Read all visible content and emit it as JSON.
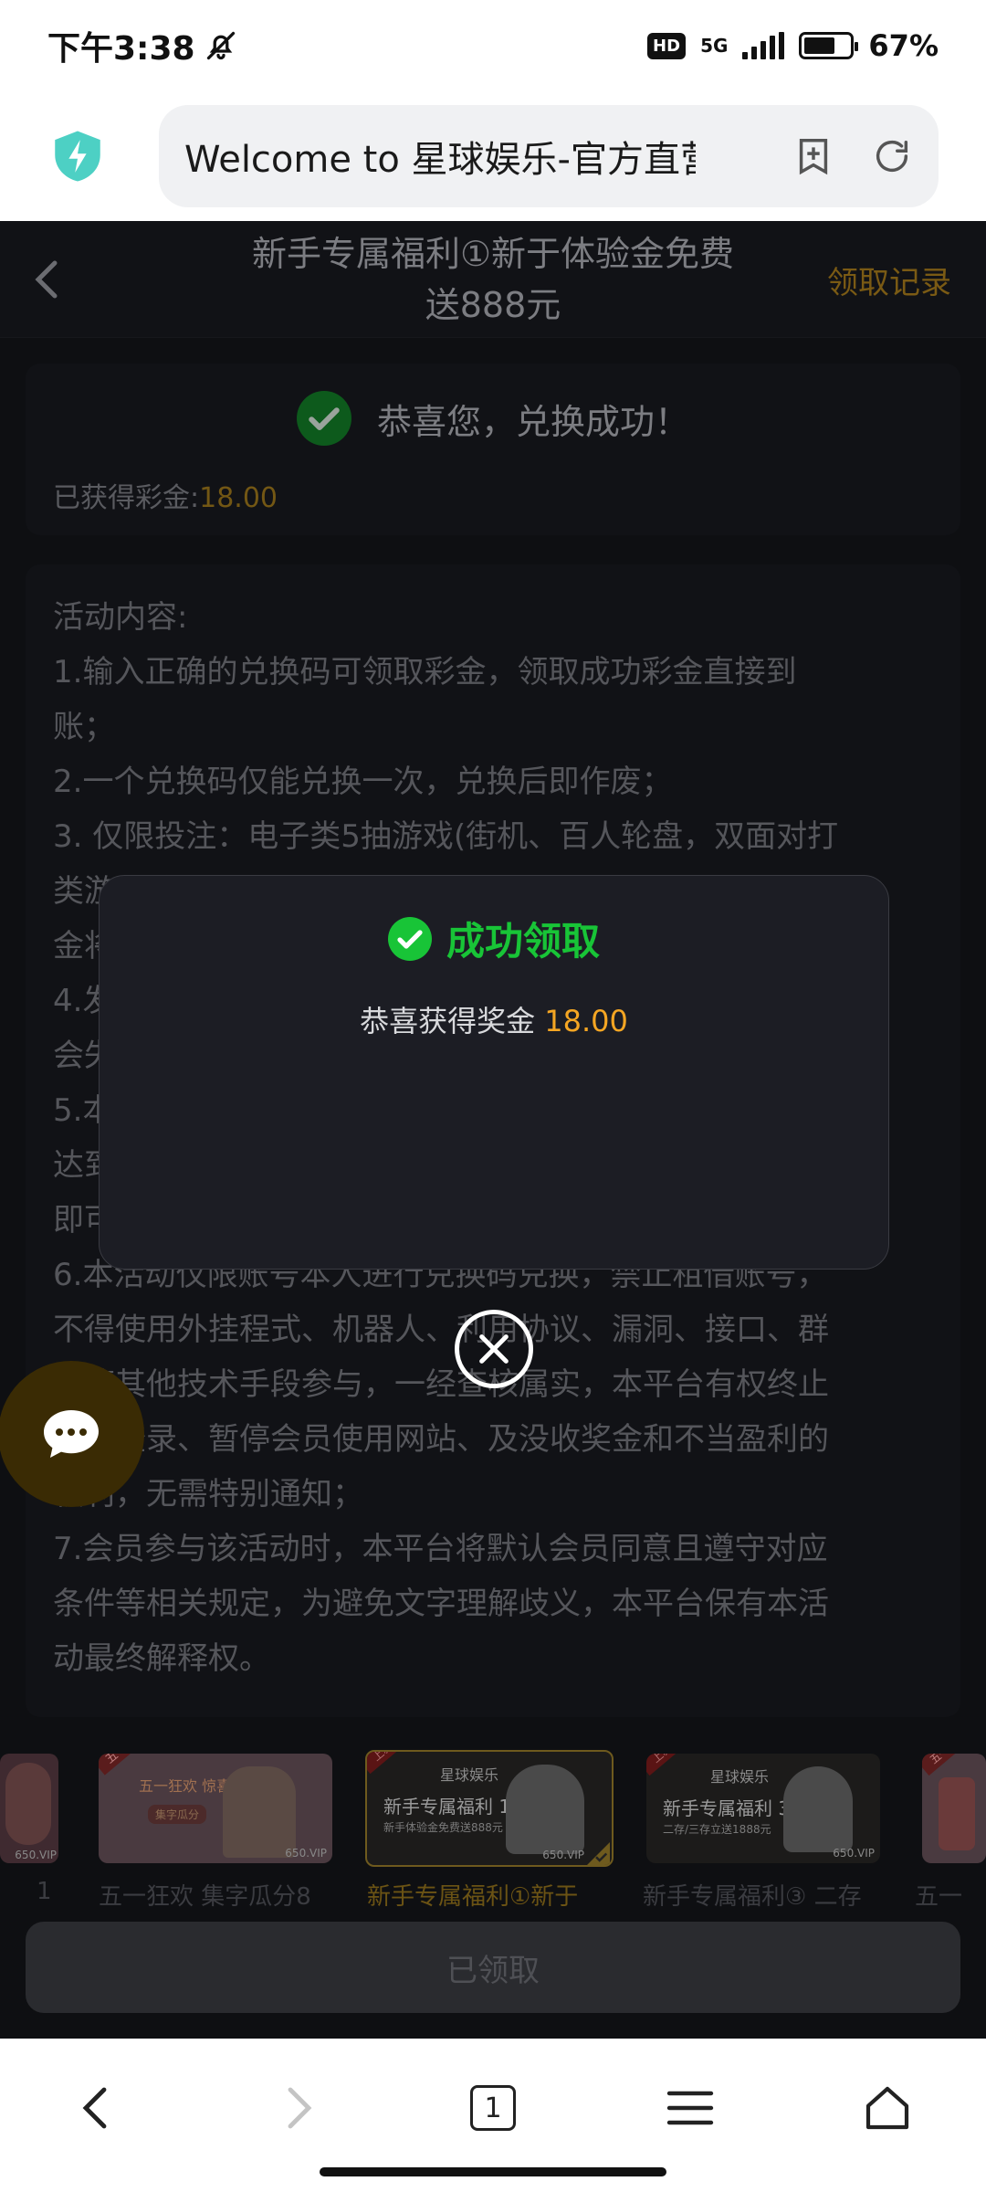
{
  "status_bar": {
    "time": "下午3:38",
    "network": "5G",
    "hd": "HD",
    "battery": "67%",
    "battery_level": 0.67
  },
  "browser": {
    "url_text": "Welcome to 星球娱乐-官方直营"
  },
  "header": {
    "title_line1": "新手专属福利①新于体验金免费",
    "title_line2": "送888元",
    "records_link": "领取记录"
  },
  "success": {
    "message": "恭喜您，兑换成功！",
    "earned_label": "已获得彩金:",
    "earned_amount": "18.00"
  },
  "rules": {
    "lines": [
      "活动内容:",
      "1.输入正确的兑换码可领取彩金，领取成功彩金直接到",
      "账；",
      "2.一个兑换码仅能兑换一次，兑换后即作废；",
      "3. 仅限投注：电子类5抽游戏(街机、百人轮盘，双面对打",
      "类游戏除外)，体验金须在有效期内完成投注，否则彩",
      "金将会被清除；",
      "4.发放时间为领取后即刻到账，逾期未领取彩金将",
      "会失效；",
      "5.本活动彩金需要完成彩金的1倍流水方可提款，盈利",
      "达到提款门槛即可提款，会员需要在领取后完成流水",
      "即可申请提款；",
      "6.本活动仅限账号本人进行兑换码兑换，禁止租借账号，",
      "不得使用外挂程式、机器人、利用协议、漏洞、接口、群",
      "控等其他技术手段参与，一经查核属实，本平台有权终止",
      "会员登录、暂停会员使用网站、及没收奖金和不当盈利的",
      "权利，无需特别通知；",
      "7.会员参与该活动时，本平台将默认会员同意且遵守对应",
      "条件等相关规定，为避免文字理解歧义，本平台保有本活",
      "动最终解释权。"
    ]
  },
  "banners": [
    {
      "caption": "1",
      "badge": "",
      "headline": "",
      "sub": "",
      "vip": "650.VIP"
    },
    {
      "caption": "五一狂欢 集字瓜分8",
      "badge": "五一狂欢",
      "headline": "五一狂欢 惊喜有礼",
      "sub": "集字瓜分",
      "vip": "650.VIP"
    },
    {
      "caption": "新手专属福利①新于",
      "badge": "上新人",
      "headline": "新手专属福利 1",
      "sub": "新手体验金免费送888元",
      "vip": "650.VIP"
    },
    {
      "caption": "新手专属福利③ 二存",
      "badge": "上新人",
      "headline": "新手专属福利 3",
      "sub": "二存/三存立送1888元",
      "vip": "650.VIP"
    },
    {
      "caption": "五一",
      "badge": "五一",
      "headline": "",
      "sub": "",
      "vip": ""
    }
  ],
  "brand_name": "星球娱乐",
  "claim_button": "已领取",
  "dialog": {
    "title": "成功领取",
    "message_prefix": "恭喜获得奖金 ",
    "amount": "18.00"
  },
  "bottom_nav": {
    "tab_count": "1"
  },
  "colors": {
    "success_green": "#18c437",
    "gold": "#f5a623",
    "dim_gold": "#735714"
  }
}
